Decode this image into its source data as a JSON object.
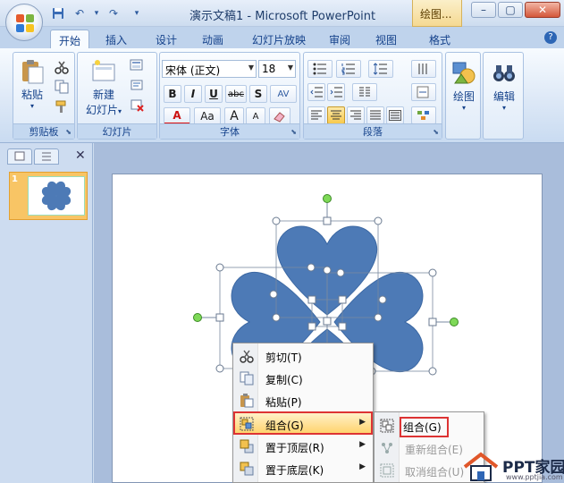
{
  "window": {
    "title": "演示文稿1 - Microsoft PowerPoint",
    "context_tab": "绘图...",
    "minimize": "–",
    "restore": "▢",
    "close": "✕"
  },
  "qat": {
    "save_icon": "save-icon",
    "undo": "↶",
    "undo_drop": "▾",
    "redo": "↷",
    "customize": "▾"
  },
  "tabs": [
    {
      "label": "开始",
      "active": true
    },
    {
      "label": "插入"
    },
    {
      "label": "设计"
    },
    {
      "label": "动画"
    },
    {
      "label": "幻灯片放映"
    },
    {
      "label": "审阅"
    },
    {
      "label": "视图"
    },
    {
      "label": "格式"
    }
  ],
  "help": "?",
  "ribbon": {
    "clipboard": {
      "label": "剪贴板",
      "paste": "粘贴",
      "paste_drop": "▾"
    },
    "slides": {
      "label": "幻灯片",
      "new_slide_1": "新建",
      "new_slide_2": "幻灯片",
      "new_slide_drop": "▾"
    },
    "font": {
      "label": "字体",
      "font_name": "宋体 (正文)",
      "font_size": "18",
      "bold": "B",
      "italic": "I",
      "underline": "U",
      "strike": "abc",
      "shadow": "S",
      "spacing": "AV",
      "color": "A",
      "case": "Aa",
      "grow": "A",
      "shrink": "A"
    },
    "paragraph": {
      "label": "段落"
    },
    "drawing": {
      "label": "绘图",
      "drop": "▾"
    },
    "editing": {
      "label": "编辑",
      "drop": "▾"
    }
  },
  "slides_panel": {
    "close": "✕",
    "slide_number": "1"
  },
  "context_menu": {
    "items": [
      {
        "label": "剪切(T)",
        "icon": "scissors-icon"
      },
      {
        "label": "复制(C)",
        "icon": "copy-icon"
      },
      {
        "label": "粘贴(P)",
        "icon": "paste-icon"
      },
      {
        "label": "组合(G)",
        "icon": "group-icon",
        "submenu": true,
        "highlighted": true
      },
      {
        "label": "置于顶层(R)",
        "icon": "bring-front-icon",
        "submenu": true
      },
      {
        "label": "置于底层(K)",
        "icon": "send-back-icon",
        "submenu": true
      }
    ],
    "submenu_arrow": "▶"
  },
  "group_submenu": {
    "items": [
      {
        "label": "组合(G)",
        "enabled": true,
        "highlighted": true
      },
      {
        "label": "重新组合(E)",
        "enabled": false
      },
      {
        "label": "取消组合(U)",
        "enabled": false
      }
    ]
  },
  "watermark": {
    "text": "PPT家园",
    "sub": "www.pptjia.com"
  },
  "colors": {
    "heart_fill": "#4d7ab6",
    "accent_red": "#dd3333",
    "ribbon_bg": "#dbe7f6",
    "slide_thumb_sel": "#f8c565"
  }
}
